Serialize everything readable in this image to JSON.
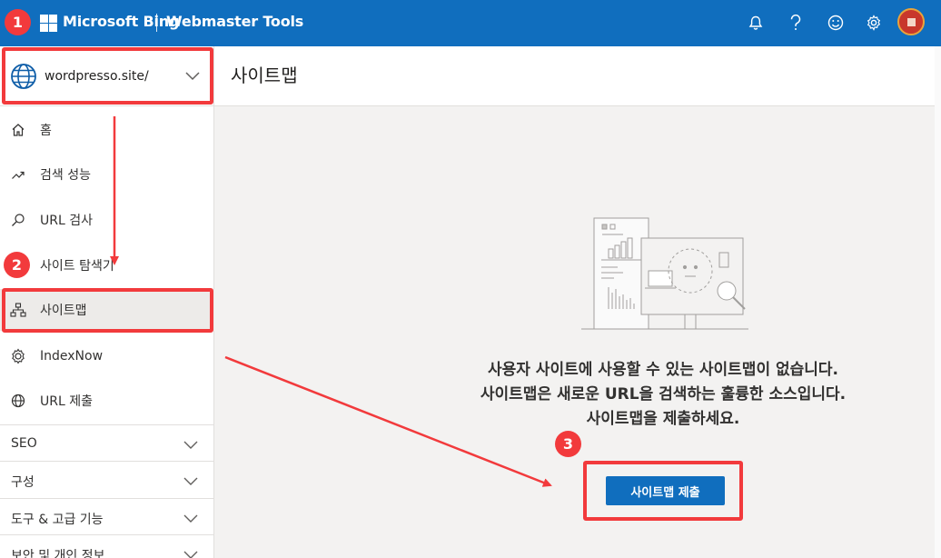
{
  "topbar": {
    "brand": "Microsoft Bing",
    "product": "Webmaster Tools",
    "icons": [
      "bell-icon",
      "help-icon",
      "smiley-icon",
      "gear-icon"
    ],
    "color": "#106ebe"
  },
  "sidebar": {
    "site": "wordpresso.site/",
    "items": [
      {
        "label": "홈",
        "icon": "home-icon"
      },
      {
        "label": "검색 성능",
        "icon": "trend-icon"
      },
      {
        "label": "URL 검사",
        "icon": "search-icon"
      },
      {
        "label": "사이트 탐색기",
        "icon": "explorer-icon"
      },
      {
        "label": "사이트맵",
        "icon": "sitemap-icon",
        "active": true
      },
      {
        "label": "IndexNow",
        "icon": "indexnow-icon"
      },
      {
        "label": "URL 제출",
        "icon": "globe-icon"
      }
    ],
    "groups": [
      "SEO",
      "구성",
      "도구 & 고급 기능",
      "보안 및 개인 정보"
    ]
  },
  "main": {
    "title": "사이트맵",
    "empty_lines": [
      "사용자 사이트에 사용할 수 있는 사이트맵이 없습니다.",
      "사이트맵은 새로운 URL을 검색하는 훌륭한 소스입니다.",
      "사이트맵을 제출하세요."
    ],
    "submit_label": "사이트맵 제출"
  },
  "annotations": {
    "steps": [
      "1",
      "2",
      "3"
    ],
    "color": "#f23a3c"
  }
}
